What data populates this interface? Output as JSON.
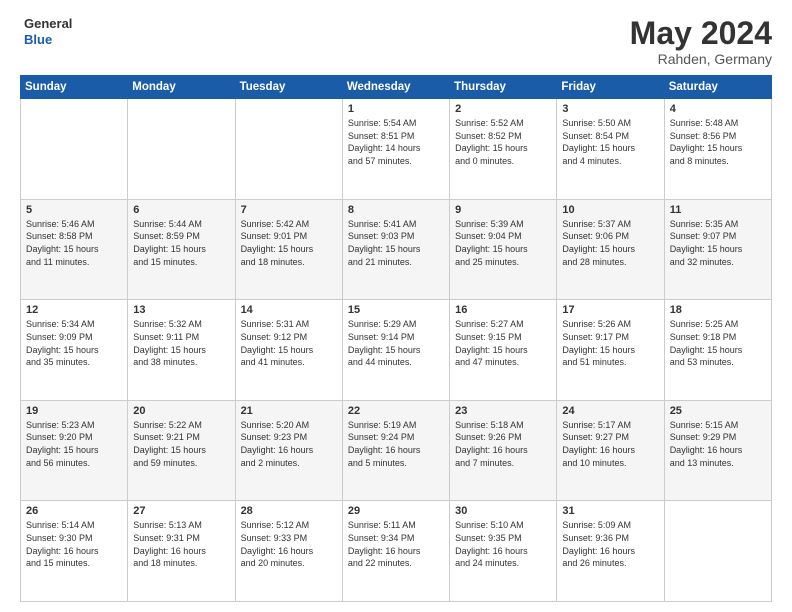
{
  "logo": {
    "line1": "General",
    "line2": "Blue"
  },
  "header": {
    "title": "May 2024",
    "subtitle": "Rahden, Germany"
  },
  "days_of_week": [
    "Sunday",
    "Monday",
    "Tuesday",
    "Wednesday",
    "Thursday",
    "Friday",
    "Saturday"
  ],
  "weeks": [
    [
      {
        "day": "",
        "info": ""
      },
      {
        "day": "",
        "info": ""
      },
      {
        "day": "",
        "info": ""
      },
      {
        "day": "1",
        "info": "Sunrise: 5:54 AM\nSunset: 8:51 PM\nDaylight: 14 hours\nand 57 minutes."
      },
      {
        "day": "2",
        "info": "Sunrise: 5:52 AM\nSunset: 8:52 PM\nDaylight: 15 hours\nand 0 minutes."
      },
      {
        "day": "3",
        "info": "Sunrise: 5:50 AM\nSunset: 8:54 PM\nDaylight: 15 hours\nand 4 minutes."
      },
      {
        "day": "4",
        "info": "Sunrise: 5:48 AM\nSunset: 8:56 PM\nDaylight: 15 hours\nand 8 minutes."
      }
    ],
    [
      {
        "day": "5",
        "info": "Sunrise: 5:46 AM\nSunset: 8:58 PM\nDaylight: 15 hours\nand 11 minutes."
      },
      {
        "day": "6",
        "info": "Sunrise: 5:44 AM\nSunset: 8:59 PM\nDaylight: 15 hours\nand 15 minutes."
      },
      {
        "day": "7",
        "info": "Sunrise: 5:42 AM\nSunset: 9:01 PM\nDaylight: 15 hours\nand 18 minutes."
      },
      {
        "day": "8",
        "info": "Sunrise: 5:41 AM\nSunset: 9:03 PM\nDaylight: 15 hours\nand 21 minutes."
      },
      {
        "day": "9",
        "info": "Sunrise: 5:39 AM\nSunset: 9:04 PM\nDaylight: 15 hours\nand 25 minutes."
      },
      {
        "day": "10",
        "info": "Sunrise: 5:37 AM\nSunset: 9:06 PM\nDaylight: 15 hours\nand 28 minutes."
      },
      {
        "day": "11",
        "info": "Sunrise: 5:35 AM\nSunset: 9:07 PM\nDaylight: 15 hours\nand 32 minutes."
      }
    ],
    [
      {
        "day": "12",
        "info": "Sunrise: 5:34 AM\nSunset: 9:09 PM\nDaylight: 15 hours\nand 35 minutes."
      },
      {
        "day": "13",
        "info": "Sunrise: 5:32 AM\nSunset: 9:11 PM\nDaylight: 15 hours\nand 38 minutes."
      },
      {
        "day": "14",
        "info": "Sunrise: 5:31 AM\nSunset: 9:12 PM\nDaylight: 15 hours\nand 41 minutes."
      },
      {
        "day": "15",
        "info": "Sunrise: 5:29 AM\nSunset: 9:14 PM\nDaylight: 15 hours\nand 44 minutes."
      },
      {
        "day": "16",
        "info": "Sunrise: 5:27 AM\nSunset: 9:15 PM\nDaylight: 15 hours\nand 47 minutes."
      },
      {
        "day": "17",
        "info": "Sunrise: 5:26 AM\nSunset: 9:17 PM\nDaylight: 15 hours\nand 51 minutes."
      },
      {
        "day": "18",
        "info": "Sunrise: 5:25 AM\nSunset: 9:18 PM\nDaylight: 15 hours\nand 53 minutes."
      }
    ],
    [
      {
        "day": "19",
        "info": "Sunrise: 5:23 AM\nSunset: 9:20 PM\nDaylight: 15 hours\nand 56 minutes."
      },
      {
        "day": "20",
        "info": "Sunrise: 5:22 AM\nSunset: 9:21 PM\nDaylight: 15 hours\nand 59 minutes."
      },
      {
        "day": "21",
        "info": "Sunrise: 5:20 AM\nSunset: 9:23 PM\nDaylight: 16 hours\nand 2 minutes."
      },
      {
        "day": "22",
        "info": "Sunrise: 5:19 AM\nSunset: 9:24 PM\nDaylight: 16 hours\nand 5 minutes."
      },
      {
        "day": "23",
        "info": "Sunrise: 5:18 AM\nSunset: 9:26 PM\nDaylight: 16 hours\nand 7 minutes."
      },
      {
        "day": "24",
        "info": "Sunrise: 5:17 AM\nSunset: 9:27 PM\nDaylight: 16 hours\nand 10 minutes."
      },
      {
        "day": "25",
        "info": "Sunrise: 5:15 AM\nSunset: 9:29 PM\nDaylight: 16 hours\nand 13 minutes."
      }
    ],
    [
      {
        "day": "26",
        "info": "Sunrise: 5:14 AM\nSunset: 9:30 PM\nDaylight: 16 hours\nand 15 minutes."
      },
      {
        "day": "27",
        "info": "Sunrise: 5:13 AM\nSunset: 9:31 PM\nDaylight: 16 hours\nand 18 minutes."
      },
      {
        "day": "28",
        "info": "Sunrise: 5:12 AM\nSunset: 9:33 PM\nDaylight: 16 hours\nand 20 minutes."
      },
      {
        "day": "29",
        "info": "Sunrise: 5:11 AM\nSunset: 9:34 PM\nDaylight: 16 hours\nand 22 minutes."
      },
      {
        "day": "30",
        "info": "Sunrise: 5:10 AM\nSunset: 9:35 PM\nDaylight: 16 hours\nand 24 minutes."
      },
      {
        "day": "31",
        "info": "Sunrise: 5:09 AM\nSunset: 9:36 PM\nDaylight: 16 hours\nand 26 minutes."
      },
      {
        "day": "",
        "info": ""
      }
    ]
  ]
}
